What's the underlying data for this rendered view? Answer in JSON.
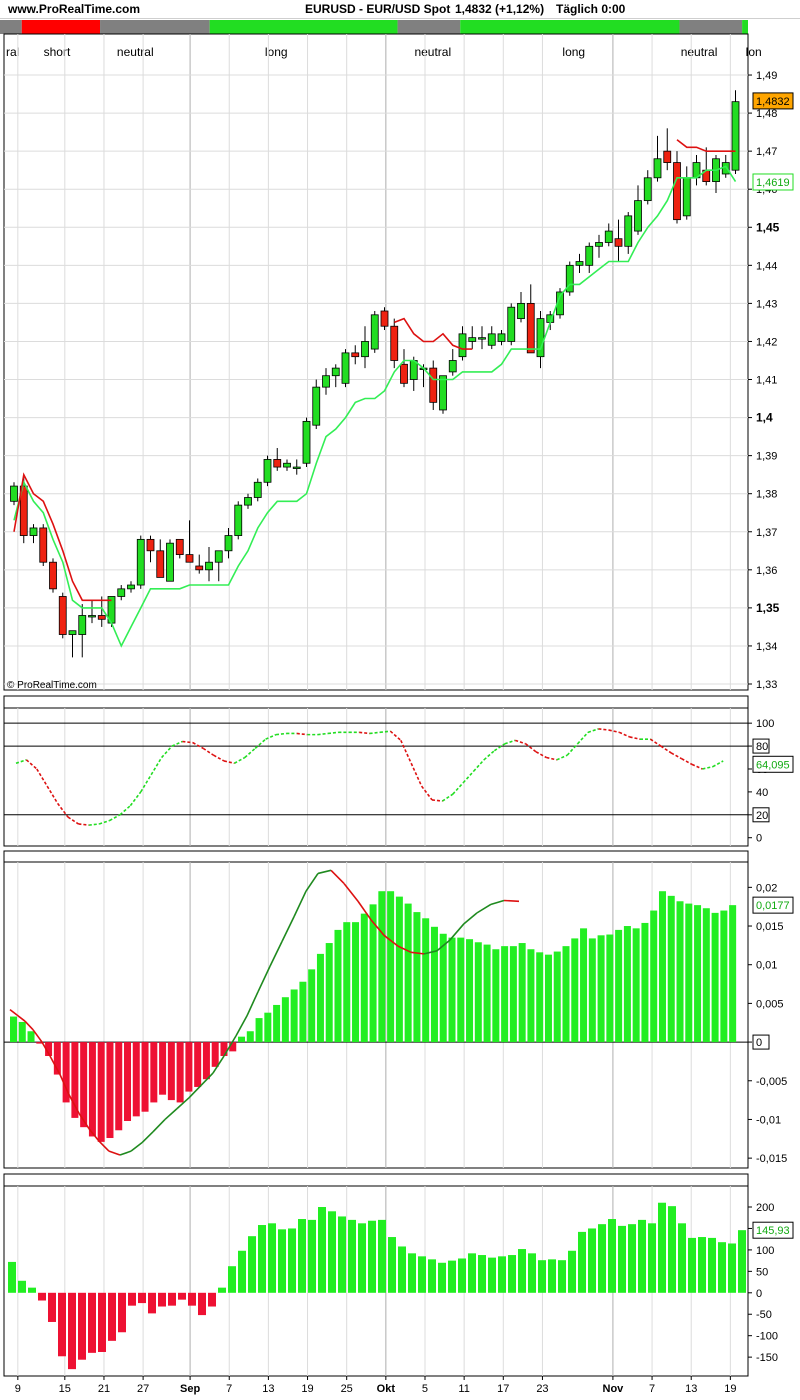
{
  "header": {
    "site": "www.ProRealTime.com",
    "title": "EURUSD - EUR/USD Spot",
    "quote": "1,4832 (+1,12%)",
    "timeframe": "Täglich  0:00"
  },
  "watermark": "© ProRealTime.com",
  "colors": {
    "up": "#22dd22",
    "down": "#ee2211",
    "neutral": "#808080",
    "price_badge": "#ffa500",
    "hist_pos": "#22ee22",
    "hist_neg": "#ee1133",
    "stop_line": "#dd1111",
    "trail_line": "#33ee55",
    "grid": "#dcdcdc",
    "month_grid": "#b4b4b4"
  },
  "regime_bar": {
    "segments": [
      {
        "state": "neutral",
        "from": 0,
        "to": 1
      },
      {
        "state": "short",
        "from": 2,
        "to": 11
      },
      {
        "state": "neutral",
        "from": 12,
        "to": 25
      },
      {
        "state": "long",
        "from": 26,
        "to": 49
      },
      {
        "state": "neutral",
        "from": 50,
        "to": 57
      },
      {
        "state": "long",
        "from": 58,
        "to": 85
      },
      {
        "state": "neutral",
        "from": 86,
        "to": 93
      },
      {
        "state": "long",
        "from": 94,
        "to": 96
      }
    ],
    "labels": [
      {
        "text": "ral",
        "bar": 0
      },
      {
        "text": "short",
        "bar": 6
      },
      {
        "text": "neutral",
        "bar": 16
      },
      {
        "text": "long",
        "bar": 34
      },
      {
        "text": "neutral",
        "bar": 54
      },
      {
        "text": "long",
        "bar": 72
      },
      {
        "text": "neutral",
        "bar": 88
      },
      {
        "text": "lon",
        "bar": 96
      }
    ]
  },
  "x_axis": {
    "labels": [
      {
        "text": "9",
        "bar": 1
      },
      {
        "text": "15",
        "bar": 7
      },
      {
        "text": "21",
        "bar": 12
      },
      {
        "text": "27",
        "bar": 17
      },
      {
        "text": "Sep",
        "bar": 23,
        "bold": true
      },
      {
        "text": "7",
        "bar": 28
      },
      {
        "text": "13",
        "bar": 33
      },
      {
        "text": "19",
        "bar": 38
      },
      {
        "text": "25",
        "bar": 43
      },
      {
        "text": "Okt",
        "bar": 48,
        "bold": true
      },
      {
        "text": "5",
        "bar": 53
      },
      {
        "text": "11",
        "bar": 58
      },
      {
        "text": "17",
        "bar": 63
      },
      {
        "text": "23",
        "bar": 68
      },
      {
        "text": "Nov",
        "bar": 77,
        "bold": true
      },
      {
        "text": "7",
        "bar": 82
      },
      {
        "text": "13",
        "bar": 87
      },
      {
        "text": "19",
        "bar": 92
      }
    ],
    "month_lines": [
      23,
      48,
      77
    ]
  },
  "chart_data": [
    {
      "type": "candlestick",
      "name": "price",
      "ylim": [
        1.33,
        1.495
      ],
      "y_ticks": [
        "1,49",
        "1,48",
        "1,47",
        "1,46",
        "1,45",
        "1,44",
        "1,43",
        "1,42",
        "1,41",
        "1,4",
        "1,39",
        "1,38",
        "1,37",
        "1,36",
        "1,35",
        "1,34",
        "1,33"
      ],
      "y_tick_values": [
        1.49,
        1.48,
        1.47,
        1.46,
        1.45,
        1.44,
        1.43,
        1.42,
        1.41,
        1.4,
        1.39,
        1.38,
        1.37,
        1.36,
        1.35,
        1.34,
        1.33
      ],
      "bold_ticks": [
        1.45,
        1.4,
        1.35
      ],
      "last_price_label": "1,4832",
      "last_price": 1.4832,
      "trail_label": "1,4619",
      "trail_value": 1.4619,
      "candles": [
        [
          1.378,
          1.383,
          1.377,
          1.382
        ],
        [
          1.382,
          1.385,
          1.367,
          1.369
        ],
        [
          1.369,
          1.372,
          1.367,
          1.371
        ],
        [
          1.371,
          1.372,
          1.361,
          1.362
        ],
        [
          1.362,
          1.363,
          1.354,
          1.355
        ],
        [
          1.353,
          1.354,
          1.342,
          1.343
        ],
        [
          1.343,
          1.344,
          1.337,
          1.344
        ],
        [
          1.343,
          1.351,
          1.337,
          1.348
        ],
        [
          1.348,
          1.352,
          1.346,
          1.348
        ],
        [
          1.348,
          1.353,
          1.345,
          1.347
        ],
        [
          1.346,
          1.352,
          1.345,
          1.353
        ],
        [
          1.353,
          1.356,
          1.352,
          1.355
        ],
        [
          1.355,
          1.357,
          1.354,
          1.356
        ],
        [
          1.356,
          1.369,
          1.355,
          1.368
        ],
        [
          1.368,
          1.369,
          1.362,
          1.365
        ],
        [
          1.365,
          1.368,
          1.358,
          1.358
        ],
        [
          1.357,
          1.368,
          1.357,
          1.367
        ],
        [
          1.368,
          1.368,
          1.363,
          1.364
        ],
        [
          1.364,
          1.373,
          1.362,
          1.362
        ],
        [
          1.361,
          1.364,
          1.359,
          1.36
        ],
        [
          1.36,
          1.366,
          1.357,
          1.362
        ],
        [
          1.362,
          1.365,
          1.357,
          1.365
        ],
        [
          1.365,
          1.371,
          1.363,
          1.369
        ],
        [
          1.369,
          1.378,
          1.368,
          1.377
        ],
        [
          1.377,
          1.38,
          1.376,
          1.379
        ],
        [
          1.379,
          1.384,
          1.378,
          1.383
        ],
        [
          1.383,
          1.39,
          1.382,
          1.389
        ],
        [
          1.389,
          1.392,
          1.386,
          1.387
        ],
        [
          1.387,
          1.389,
          1.386,
          1.388
        ],
        [
          1.387,
          1.389,
          1.385,
          1.387
        ],
        [
          1.388,
          1.4,
          1.387,
          1.399
        ],
        [
          1.398,
          1.41,
          1.397,
          1.408
        ],
        [
          1.408,
          1.413,
          1.406,
          1.411
        ],
        [
          1.411,
          1.414,
          1.408,
          1.413
        ],
        [
          1.409,
          1.418,
          1.408,
          1.417
        ],
        [
          1.417,
          1.419,
          1.414,
          1.416
        ],
        [
          1.416,
          1.424,
          1.413,
          1.42
        ],
        [
          1.418,
          1.428,
          1.417,
          1.427
        ],
        [
          1.428,
          1.429,
          1.423,
          1.424
        ],
        [
          1.424,
          1.426,
          1.413,
          1.415
        ],
        [
          1.414,
          1.418,
          1.408,
          1.409
        ],
        [
          1.41,
          1.416,
          1.407,
          1.415
        ],
        [
          1.413,
          1.414,
          1.408,
          1.413
        ],
        [
          1.413,
          1.415,
          1.402,
          1.404
        ],
        [
          1.402,
          1.411,
          1.401,
          1.411
        ],
        [
          1.412,
          1.418,
          1.411,
          1.415
        ],
        [
          1.416,
          1.424,
          1.415,
          1.422
        ],
        [
          1.42,
          1.424,
          1.418,
          1.421
        ],
        [
          1.421,
          1.424,
          1.418,
          1.421
        ],
        [
          1.419,
          1.424,
          1.418,
          1.422
        ],
        [
          1.42,
          1.423,
          1.419,
          1.422
        ],
        [
          1.42,
          1.43,
          1.419,
          1.429
        ],
        [
          1.426,
          1.433,
          1.425,
          1.43
        ],
        [
          1.43,
          1.435,
          1.42,
          1.417
        ],
        [
          1.416,
          1.428,
          1.413,
          1.426
        ],
        [
          1.425,
          1.428,
          1.423,
          1.427
        ],
        [
          1.427,
          1.434,
          1.426,
          1.433
        ],
        [
          1.433,
          1.441,
          1.432,
          1.44
        ],
        [
          1.44,
          1.443,
          1.438,
          1.441
        ],
        [
          1.44,
          1.446,
          1.438,
          1.445
        ],
        [
          1.445,
          1.448,
          1.442,
          1.446
        ],
        [
          1.446,
          1.451,
          1.445,
          1.449
        ],
        [
          1.447,
          1.452,
          1.441,
          1.445
        ],
        [
          1.445,
          1.454,
          1.443,
          1.453
        ],
        [
          1.449,
          1.461,
          1.448,
          1.457
        ],
        [
          1.457,
          1.465,
          1.456,
          1.463
        ],
        [
          1.463,
          1.474,
          1.462,
          1.468
        ],
        [
          1.47,
          1.476,
          1.465,
          1.467
        ],
        [
          1.467,
          1.47,
          1.451,
          1.452
        ],
        [
          1.453,
          1.466,
          1.452,
          1.463
        ],
        [
          1.463,
          1.469,
          1.461,
          1.467
        ],
        [
          1.465,
          1.471,
          1.461,
          1.462
        ],
        [
          1.462,
          1.469,
          1.459,
          1.468
        ],
        [
          1.464,
          1.469,
          1.463,
          1.467
        ],
        [
          1.465,
          1.486,
          1.464,
          1.483
        ]
      ],
      "candle_bar_start": 1,
      "candle_bar_step": 1.3,
      "trail_stop": [
        1.373,
        1.383,
        1.378,
        1.375,
        1.368,
        1.362,
        1.352,
        1.35,
        1.35,
        1.35,
        1.346,
        1.34,
        1.345,
        1.35,
        1.355,
        1.355,
        1.355,
        1.355,
        1.356,
        1.356,
        1.356,
        1.356,
        1.356,
        1.361,
        1.365,
        1.371,
        1.375,
        1.378,
        1.378,
        1.378,
        1.38,
        1.388,
        1.395,
        1.397,
        1.4,
        1.404,
        1.405,
        1.405,
        1.407,
        1.412,
        1.415,
        1.415,
        1.413,
        1.41,
        1.41,
        1.41,
        1.412,
        1.412,
        1.412,
        1.412,
        1.414,
        1.418,
        1.418,
        1.418,
        1.418,
        1.425,
        1.432,
        1.435,
        1.435,
        1.437,
        1.439,
        1.441,
        1.441,
        1.441,
        1.446,
        1.45,
        1.453,
        1.457,
        1.463,
        1.463,
        1.463,
        1.465,
        1.465,
        1.466,
        1.462
      ],
      "short_stop": [
        1.37,
        1.385,
        1.38,
        1.378,
        1.372,
        1.365,
        1.357,
        1.352,
        1.352,
        1.352,
        1.352
      ],
      "upper_stop": [
        1.425,
        1.426,
        1.422,
        1.42,
        1.42,
        1.422,
        1.419,
        1.418,
        1.418
      ],
      "upper_stop_start": 39,
      "top_stop": [
        1.473,
        1.471,
        1.471,
        1.47,
        1.47,
        1.47,
        1.47
      ],
      "top_stop_start": 68
    },
    {
      "type": "line",
      "name": "stochastic",
      "ylim": [
        -2,
        108
      ],
      "y_ticks": [
        "100",
        "80",
        "60",
        "40",
        "20",
        "0"
      ],
      "y_tick_values": [
        100,
        80,
        60,
        40,
        20,
        0
      ],
      "boxed_ticks": [
        80,
        20
      ],
      "hlines": [
        100,
        80,
        20
      ],
      "last_label": "64,095",
      "last_value": 64.1,
      "values": [
        65,
        68,
        60,
        45,
        30,
        18,
        12,
        11,
        12,
        15,
        20,
        28,
        40,
        55,
        70,
        80,
        84,
        83,
        78,
        72,
        67,
        65,
        70,
        78,
        86,
        90,
        91,
        91,
        90,
        90,
        91,
        92,
        92,
        92,
        91,
        92,
        93,
        85,
        65,
        45,
        33,
        32,
        38,
        48,
        58,
        68,
        76,
        82,
        85,
        82,
        75,
        70,
        68,
        72,
        82,
        92,
        95,
        94,
        92,
        88,
        86,
        86,
        80,
        74,
        69,
        64,
        60,
        62,
        67
      ],
      "step": 10.4,
      "x0": 16
    },
    {
      "type": "bar+line",
      "name": "macd",
      "ylim": [
        -0.0155,
        0.0225
      ],
      "y_ticks": [
        "0,02",
        "0,015",
        "0,01",
        "0,005",
        "0",
        "-0,005",
        "-0,01",
        "-0,015"
      ],
      "y_tick_values": [
        0.02,
        0.015,
        0.01,
        0.005,
        0,
        -0.005,
        -0.01,
        -0.015
      ],
      "boxed_ticks": [
        0
      ],
      "last_label": "0,0177",
      "last_value": 0.0177,
      "histogram": [
        0.0033,
        0.0026,
        0.0014,
        -0.0002,
        -0.0018,
        -0.0042,
        -0.0078,
        -0.0098,
        -0.011,
        -0.0122,
        -0.0129,
        -0.0124,
        -0.0114,
        -0.0102,
        -0.0096,
        -0.009,
        -0.0078,
        -0.0068,
        -0.0075,
        -0.0078,
        -0.0064,
        -0.0058,
        -0.0048,
        -0.0032,
        -0.0018,
        -0.0012,
        0.0007,
        0.0014,
        0.0031,
        0.0038,
        0.0048,
        0.0058,
        0.0068,
        0.0078,
        0.0094,
        0.0114,
        0.0128,
        0.0145,
        0.0155,
        0.0155,
        0.0166,
        0.0178,
        0.0195,
        0.0195,
        0.0188,
        0.0179,
        0.0168,
        0.016,
        0.0149,
        0.014,
        0.0135,
        0.0135,
        0.0133,
        0.0129,
        0.0126,
        0.012,
        0.0124,
        0.0124,
        0.0128,
        0.012,
        0.0116,
        0.0113,
        0.0117,
        0.0124,
        0.0134,
        0.0147,
        0.0134,
        0.0138,
        0.0139,
        0.0145,
        0.015,
        0.0147,
        0.0154,
        0.017,
        0.0195,
        0.0189,
        0.0182,
        0.0179,
        0.0177,
        0.0173,
        0.0167,
        0.017,
        0.0177
      ],
      "signal": [
        0.0042,
        0.0035,
        0.0027,
        0.0016,
        0.0,
        -0.0018,
        -0.0042,
        -0.0068,
        -0.0092,
        -0.0112,
        -0.0128,
        -0.0141,
        -0.0146,
        -0.0141,
        -0.013,
        -0.0116,
        -0.01,
        -0.0086,
        -0.0072,
        -0.0056,
        -0.004,
        -0.0018,
        0.0008,
        0.0034,
        0.0065,
        0.0098,
        0.013,
        0.0162,
        0.0195,
        0.0218,
        0.0222,
        0.0205,
        0.0182,
        0.0158,
        0.0138,
        0.0124,
        0.0116,
        0.0114,
        0.0118,
        0.0132,
        0.0153,
        0.0167,
        0.0178,
        0.0183,
        0.0182
      ],
      "signal_x": [
        10,
        17,
        25,
        33,
        42,
        50,
        60,
        69,
        79,
        89,
        99,
        109,
        120,
        131,
        142,
        153,
        165,
        177,
        189,
        201,
        213,
        224,
        236,
        247,
        258,
        270,
        282,
        294,
        306,
        318,
        331,
        344,
        358,
        371,
        384,
        398,
        411,
        424,
        437,
        450,
        464,
        477,
        491,
        504,
        519,
        533,
        547,
        561,
        575,
        590,
        604,
        618,
        632,
        646,
        660,
        674,
        688,
        702,
        716,
        730,
        737
      ]
    },
    {
      "type": "bar",
      "name": "cci",
      "ylim": [
        -180,
        235
      ],
      "y_ticks": [
        "200",
        "150",
        "100",
        "50",
        "0",
        "-50",
        "-100",
        "-150"
      ],
      "y_tick_values": [
        200,
        150,
        100,
        50,
        0,
        -50,
        -100,
        -150
      ],
      "boxed_ticks": [],
      "last_label": "145,93",
      "last_value": 145.93,
      "values": [
        72,
        28,
        12,
        -18,
        -68,
        -148,
        -178,
        -156,
        -140,
        -138,
        -112,
        -92,
        -30,
        -24,
        -48,
        -32,
        -30,
        -16,
        -30,
        -52,
        -32,
        12,
        62,
        98,
        132,
        158,
        162,
        148,
        150,
        172,
        170,
        200,
        190,
        178,
        170,
        162,
        168,
        170,
        130,
        108,
        92,
        85,
        78,
        70,
        75,
        80,
        92,
        88,
        82,
        85,
        88,
        102,
        92,
        76,
        78,
        76,
        98,
        142,
        150,
        160,
        172,
        156,
        160,
        170,
        162,
        210,
        202,
        162,
        128,
        130,
        128,
        118,
        115,
        146
      ]
    }
  ]
}
